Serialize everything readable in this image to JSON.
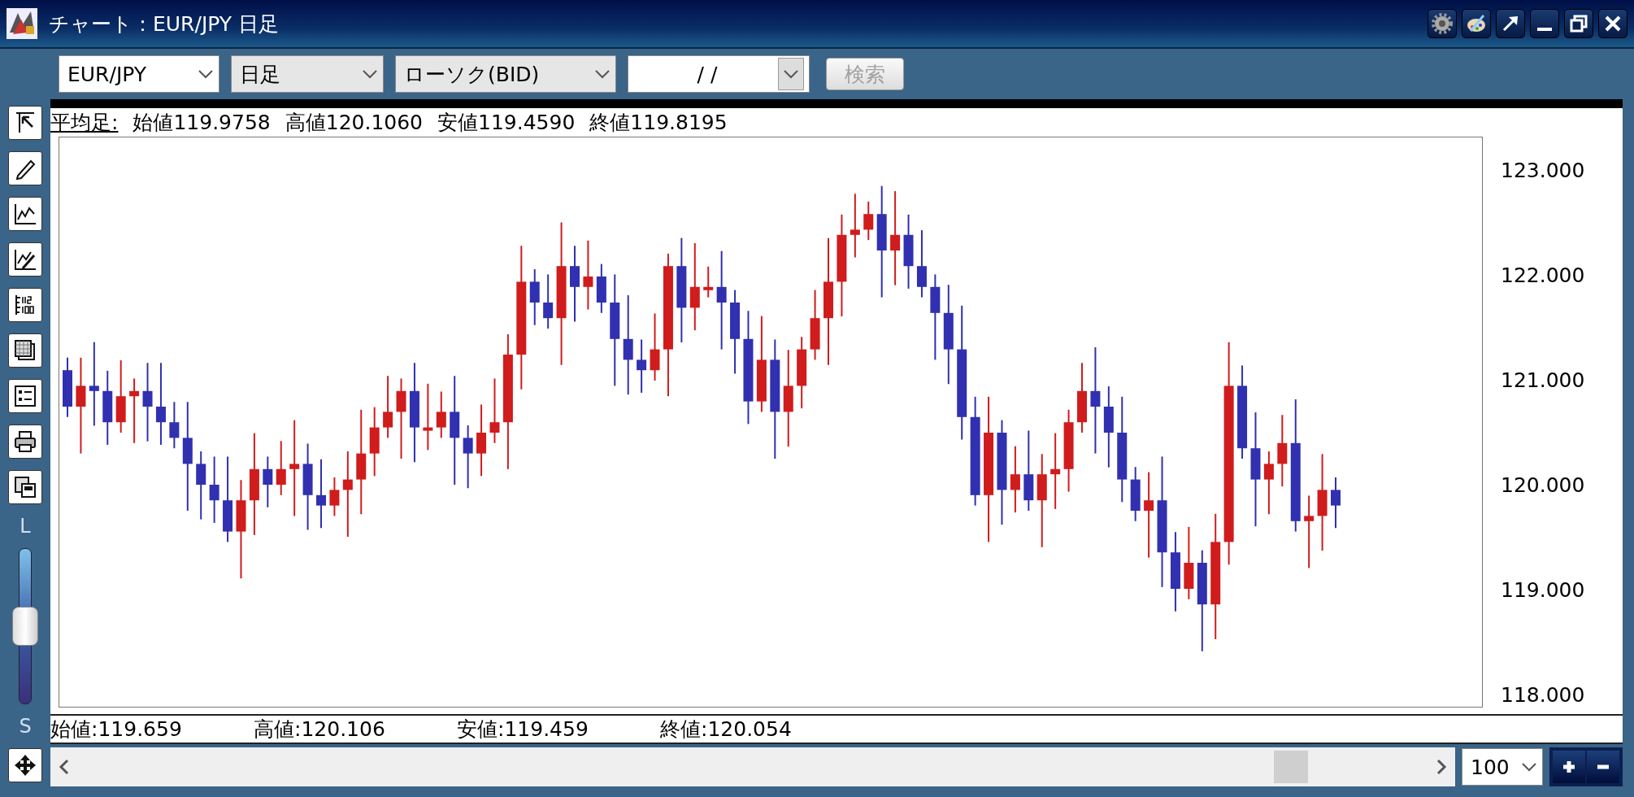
{
  "window": {
    "title": "チャート：EUR/JPY 日足"
  },
  "toolbar": {
    "pair_select": {
      "value": "EUR/JPY"
    },
    "period_select": {
      "value": "日足"
    },
    "type_select": {
      "value": "ローソク(BID)"
    },
    "date_field": {
      "value": "/ /"
    },
    "search_button": {
      "label": "検索",
      "disabled": true
    }
  },
  "sidebar": {
    "slider": {
      "top_label": "L",
      "bottom_label": "S",
      "level": 0.5
    }
  },
  "chart": {
    "header": {
      "label": "平均足:",
      "values": [
        "始値119.9758",
        "高値120.1060",
        "安値119.4590",
        "終値119.8195"
      ]
    },
    "y_axis": [
      "123.000",
      "122.000",
      "121.000",
      "120.000",
      "119.000",
      "118.000"
    ],
    "info": [
      "始値:119.659",
      "高値:120.106",
      "安値:119.459",
      "終値:120.054"
    ]
  },
  "footer": {
    "zoom_select": {
      "value": "100"
    }
  }
}
